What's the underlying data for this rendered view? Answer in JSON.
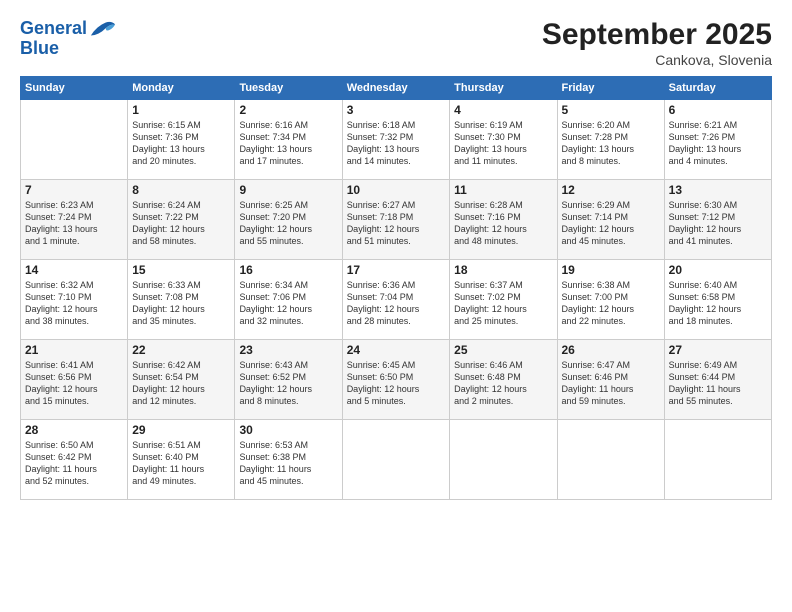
{
  "header": {
    "logo_line1": "General",
    "logo_line2": "Blue",
    "month": "September 2025",
    "location": "Cankova, Slovenia"
  },
  "days_of_week": [
    "Sunday",
    "Monday",
    "Tuesday",
    "Wednesday",
    "Thursday",
    "Friday",
    "Saturday"
  ],
  "weeks": [
    [
      {
        "day": "",
        "detail": ""
      },
      {
        "day": "1",
        "detail": "Sunrise: 6:15 AM\nSunset: 7:36 PM\nDaylight: 13 hours\nand 20 minutes."
      },
      {
        "day": "2",
        "detail": "Sunrise: 6:16 AM\nSunset: 7:34 PM\nDaylight: 13 hours\nand 17 minutes."
      },
      {
        "day": "3",
        "detail": "Sunrise: 6:18 AM\nSunset: 7:32 PM\nDaylight: 13 hours\nand 14 minutes."
      },
      {
        "day": "4",
        "detail": "Sunrise: 6:19 AM\nSunset: 7:30 PM\nDaylight: 13 hours\nand 11 minutes."
      },
      {
        "day": "5",
        "detail": "Sunrise: 6:20 AM\nSunset: 7:28 PM\nDaylight: 13 hours\nand 8 minutes."
      },
      {
        "day": "6",
        "detail": "Sunrise: 6:21 AM\nSunset: 7:26 PM\nDaylight: 13 hours\nand 4 minutes."
      }
    ],
    [
      {
        "day": "7",
        "detail": "Sunrise: 6:23 AM\nSunset: 7:24 PM\nDaylight: 13 hours\nand 1 minute."
      },
      {
        "day": "8",
        "detail": "Sunrise: 6:24 AM\nSunset: 7:22 PM\nDaylight: 12 hours\nand 58 minutes."
      },
      {
        "day": "9",
        "detail": "Sunrise: 6:25 AM\nSunset: 7:20 PM\nDaylight: 12 hours\nand 55 minutes."
      },
      {
        "day": "10",
        "detail": "Sunrise: 6:27 AM\nSunset: 7:18 PM\nDaylight: 12 hours\nand 51 minutes."
      },
      {
        "day": "11",
        "detail": "Sunrise: 6:28 AM\nSunset: 7:16 PM\nDaylight: 12 hours\nand 48 minutes."
      },
      {
        "day": "12",
        "detail": "Sunrise: 6:29 AM\nSunset: 7:14 PM\nDaylight: 12 hours\nand 45 minutes."
      },
      {
        "day": "13",
        "detail": "Sunrise: 6:30 AM\nSunset: 7:12 PM\nDaylight: 12 hours\nand 41 minutes."
      }
    ],
    [
      {
        "day": "14",
        "detail": "Sunrise: 6:32 AM\nSunset: 7:10 PM\nDaylight: 12 hours\nand 38 minutes."
      },
      {
        "day": "15",
        "detail": "Sunrise: 6:33 AM\nSunset: 7:08 PM\nDaylight: 12 hours\nand 35 minutes."
      },
      {
        "day": "16",
        "detail": "Sunrise: 6:34 AM\nSunset: 7:06 PM\nDaylight: 12 hours\nand 32 minutes."
      },
      {
        "day": "17",
        "detail": "Sunrise: 6:36 AM\nSunset: 7:04 PM\nDaylight: 12 hours\nand 28 minutes."
      },
      {
        "day": "18",
        "detail": "Sunrise: 6:37 AM\nSunset: 7:02 PM\nDaylight: 12 hours\nand 25 minutes."
      },
      {
        "day": "19",
        "detail": "Sunrise: 6:38 AM\nSunset: 7:00 PM\nDaylight: 12 hours\nand 22 minutes."
      },
      {
        "day": "20",
        "detail": "Sunrise: 6:40 AM\nSunset: 6:58 PM\nDaylight: 12 hours\nand 18 minutes."
      }
    ],
    [
      {
        "day": "21",
        "detail": "Sunrise: 6:41 AM\nSunset: 6:56 PM\nDaylight: 12 hours\nand 15 minutes."
      },
      {
        "day": "22",
        "detail": "Sunrise: 6:42 AM\nSunset: 6:54 PM\nDaylight: 12 hours\nand 12 minutes."
      },
      {
        "day": "23",
        "detail": "Sunrise: 6:43 AM\nSunset: 6:52 PM\nDaylight: 12 hours\nand 8 minutes."
      },
      {
        "day": "24",
        "detail": "Sunrise: 6:45 AM\nSunset: 6:50 PM\nDaylight: 12 hours\nand 5 minutes."
      },
      {
        "day": "25",
        "detail": "Sunrise: 6:46 AM\nSunset: 6:48 PM\nDaylight: 12 hours\nand 2 minutes."
      },
      {
        "day": "26",
        "detail": "Sunrise: 6:47 AM\nSunset: 6:46 PM\nDaylight: 11 hours\nand 59 minutes."
      },
      {
        "day": "27",
        "detail": "Sunrise: 6:49 AM\nSunset: 6:44 PM\nDaylight: 11 hours\nand 55 minutes."
      }
    ],
    [
      {
        "day": "28",
        "detail": "Sunrise: 6:50 AM\nSunset: 6:42 PM\nDaylight: 11 hours\nand 52 minutes."
      },
      {
        "day": "29",
        "detail": "Sunrise: 6:51 AM\nSunset: 6:40 PM\nDaylight: 11 hours\nand 49 minutes."
      },
      {
        "day": "30",
        "detail": "Sunrise: 6:53 AM\nSunset: 6:38 PM\nDaylight: 11 hours\nand 45 minutes."
      },
      {
        "day": "",
        "detail": ""
      },
      {
        "day": "",
        "detail": ""
      },
      {
        "day": "",
        "detail": ""
      },
      {
        "day": "",
        "detail": ""
      }
    ]
  ]
}
